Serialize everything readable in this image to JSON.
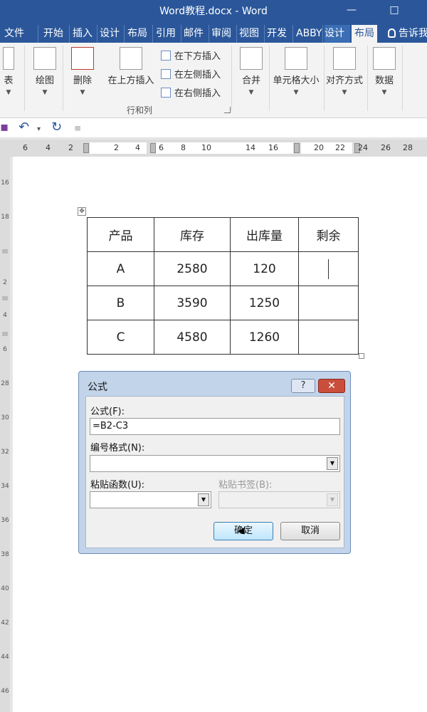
{
  "window": {
    "title": "Word教程.docx - Word"
  },
  "tabs": [
    {
      "label": "文件"
    },
    {
      "label": "开始"
    },
    {
      "label": "插入"
    },
    {
      "label": "设计"
    },
    {
      "label": "布局"
    },
    {
      "label": "引用"
    },
    {
      "label": "邮件"
    },
    {
      "label": "审阅"
    },
    {
      "label": "视图"
    },
    {
      "label": "开发"
    },
    {
      "label": "ABBY"
    },
    {
      "label": "设计"
    },
    {
      "label": "布局"
    }
  ],
  "tell_me": "告诉我",
  "ribbon": {
    "table_btn": "表",
    "draw_btn": "绘图",
    "delete_btn": "删除",
    "insert_above_btn": "在上方插入",
    "insert_below": "在下方插入",
    "insert_left": "在左侧插入",
    "insert_right": "在右侧插入",
    "group_rows_cols": "行和列",
    "merge_btn": "合并",
    "cell_size_btn": "单元格大小",
    "alignment_btn": "对齐方式",
    "data_btn": "数据"
  },
  "ruler": {
    "labels": [
      "6",
      "4",
      "2",
      "2",
      "4",
      "6",
      "8",
      "10",
      "14",
      "16",
      "20",
      "22",
      "24",
      "26",
      "28"
    ]
  },
  "vruler": {
    "labels": [
      "16",
      "18",
      "2",
      "2",
      "4",
      "2",
      "6",
      "28",
      "30",
      "32",
      "34",
      "36",
      "38",
      "40",
      "42",
      "44",
      "46"
    ]
  },
  "table": {
    "headers": [
      "产品",
      "库存",
      "出库量",
      "剩余"
    ],
    "rows": [
      [
        "A",
        "2580",
        "120",
        ""
      ],
      [
        "B",
        "3590",
        "1250",
        ""
      ],
      [
        "C",
        "4580",
        "1260",
        ""
      ]
    ]
  },
  "dialog": {
    "title": "公式",
    "help": "?",
    "close": "✕",
    "formula_label": "公式(F):",
    "formula_value": "=B2-C3",
    "number_format_label": "编号格式(N):",
    "number_format_value": "",
    "paste_function_label": "粘贴函数(U):",
    "paste_function_value": "",
    "paste_bookmark_label": "粘贴书签(B):",
    "paste_bookmark_value": "",
    "ok": "确定",
    "cancel": "取消"
  }
}
